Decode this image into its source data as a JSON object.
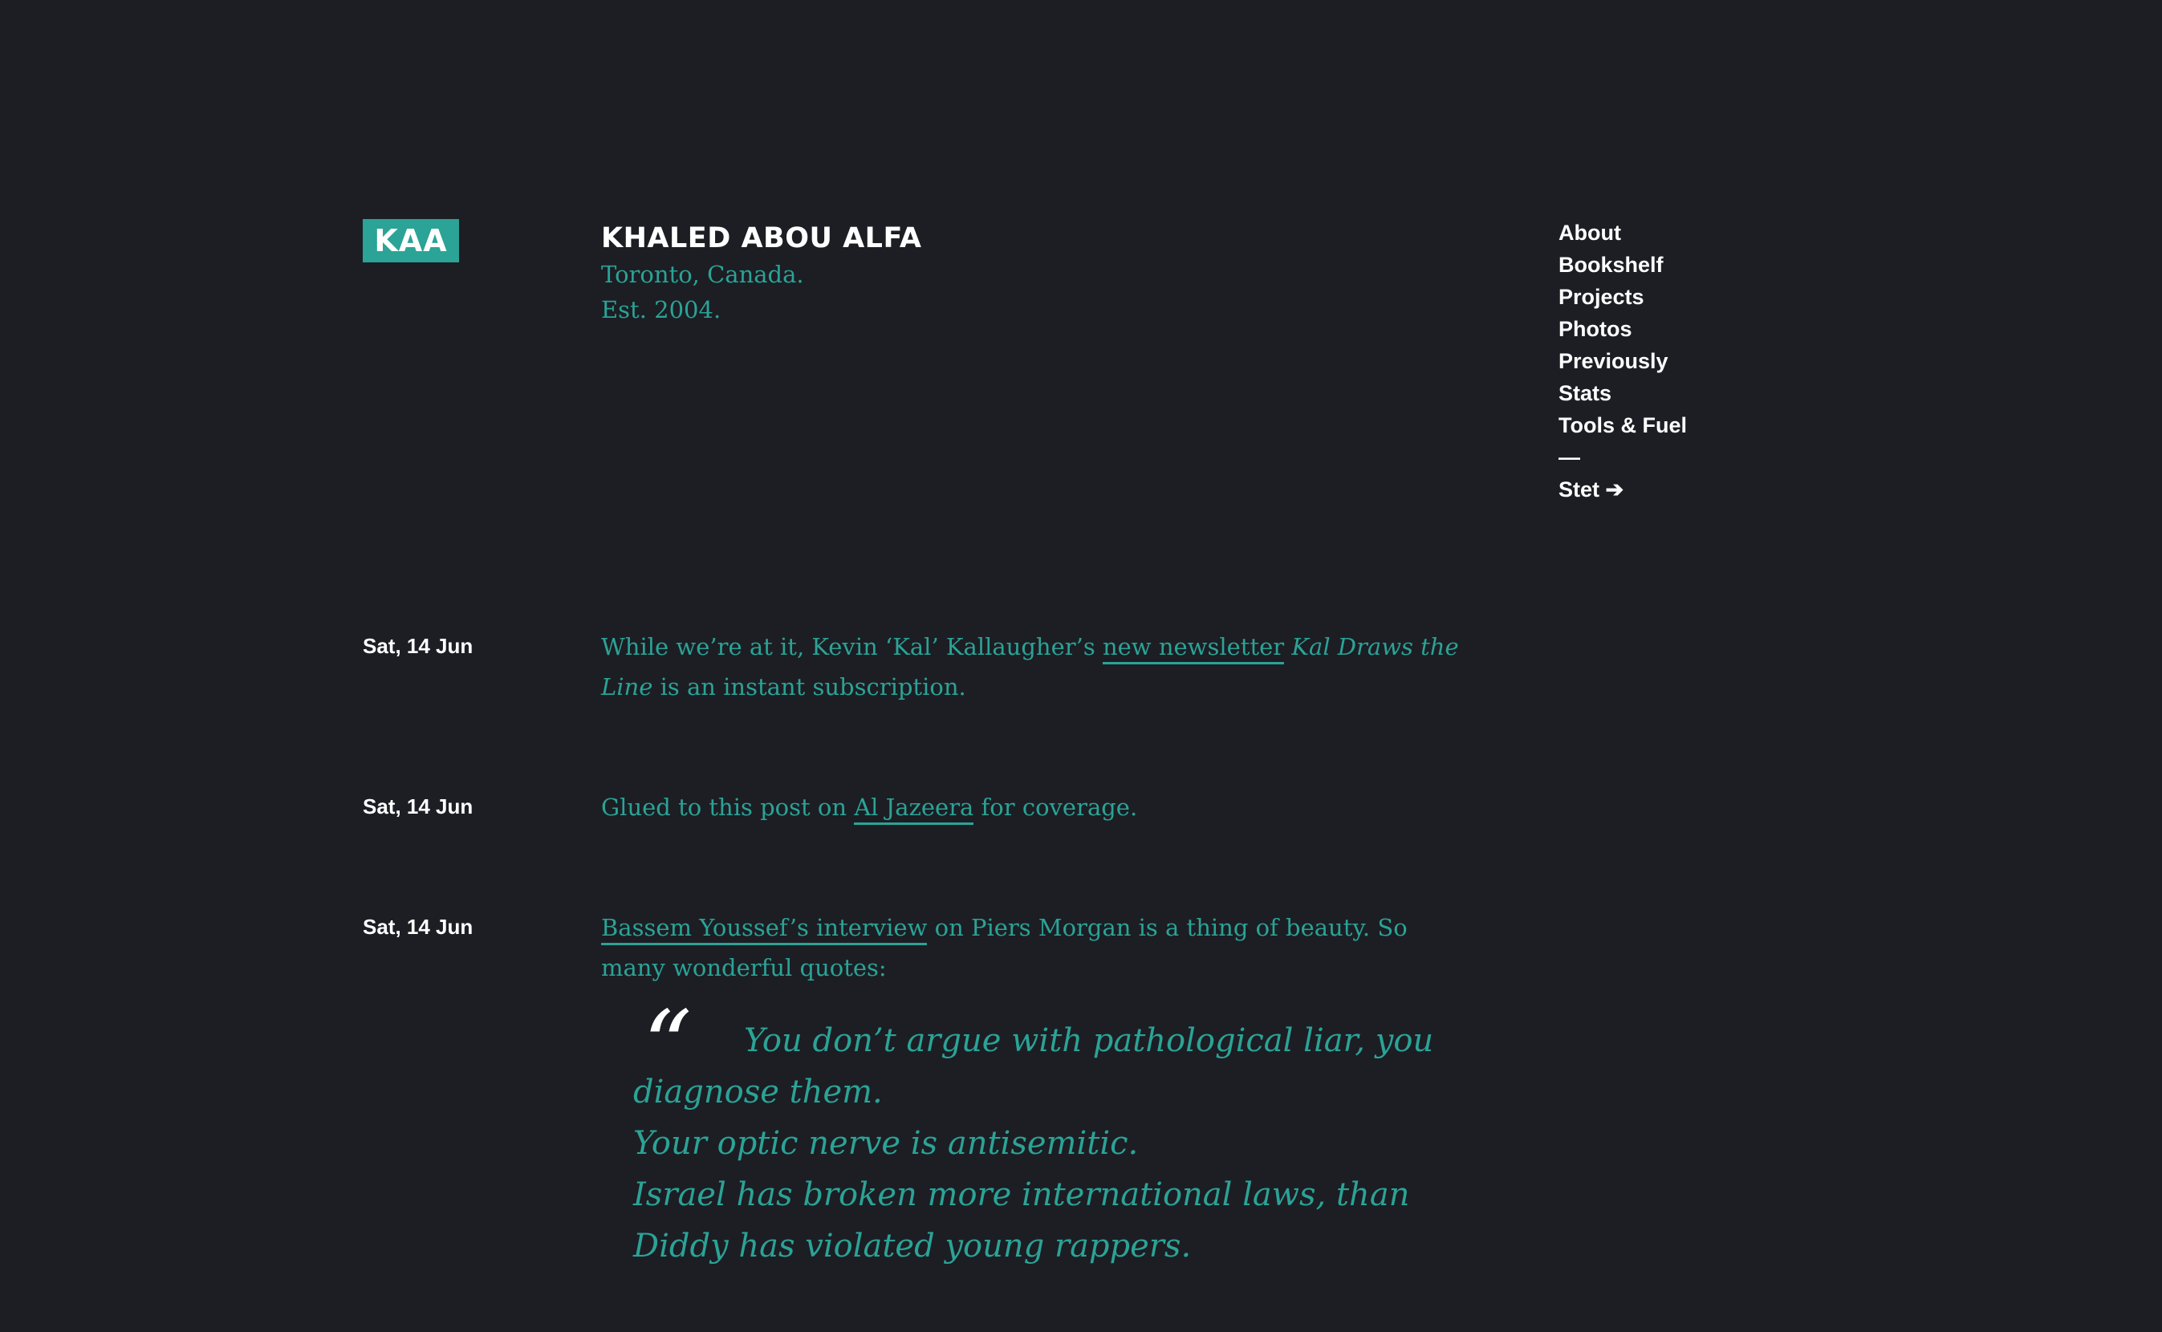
{
  "header": {
    "logo": "KAA",
    "name": "KHALED ABOU ALFA",
    "location": "Toronto, Canada.",
    "established": "Est. 2004."
  },
  "nav": {
    "items": [
      {
        "label": "About"
      },
      {
        "label": "Bookshelf"
      },
      {
        "label": "Projects"
      },
      {
        "label": "Photos"
      },
      {
        "label": "Previously"
      },
      {
        "label": "Stats"
      },
      {
        "label": "Tools & Fuel"
      }
    ],
    "separator": "—",
    "stet": "Stet ➔"
  },
  "posts": [
    {
      "date": "Sat, 14 Jun",
      "text_a": "While we’re at it, Kevin ‘Kal’ Kallaugher’s ",
      "link": "new newsletter",
      "italic": "Kal Draws the Line",
      "text_b": " is an instant subscription."
    },
    {
      "date": "Sat, 14 Jun",
      "text_a": "Glued to this post on ",
      "link": "Al Jazeera",
      "text_b": " for coverage."
    },
    {
      "date": "Sat, 14 Jun",
      "link": "Bassem Youssef’s interview",
      "text_b": " on Piers Morgan is a thing of beauty. So many wonderful quotes:",
      "quote_mark": "“",
      "quote_lines": [
        "You don’t argue with pathological liar, you diagnose them.",
        "Your optic nerve is antisemitic.",
        "Israel has broken more international laws, than Diddy has violated young rappers."
      ]
    }
  ]
}
